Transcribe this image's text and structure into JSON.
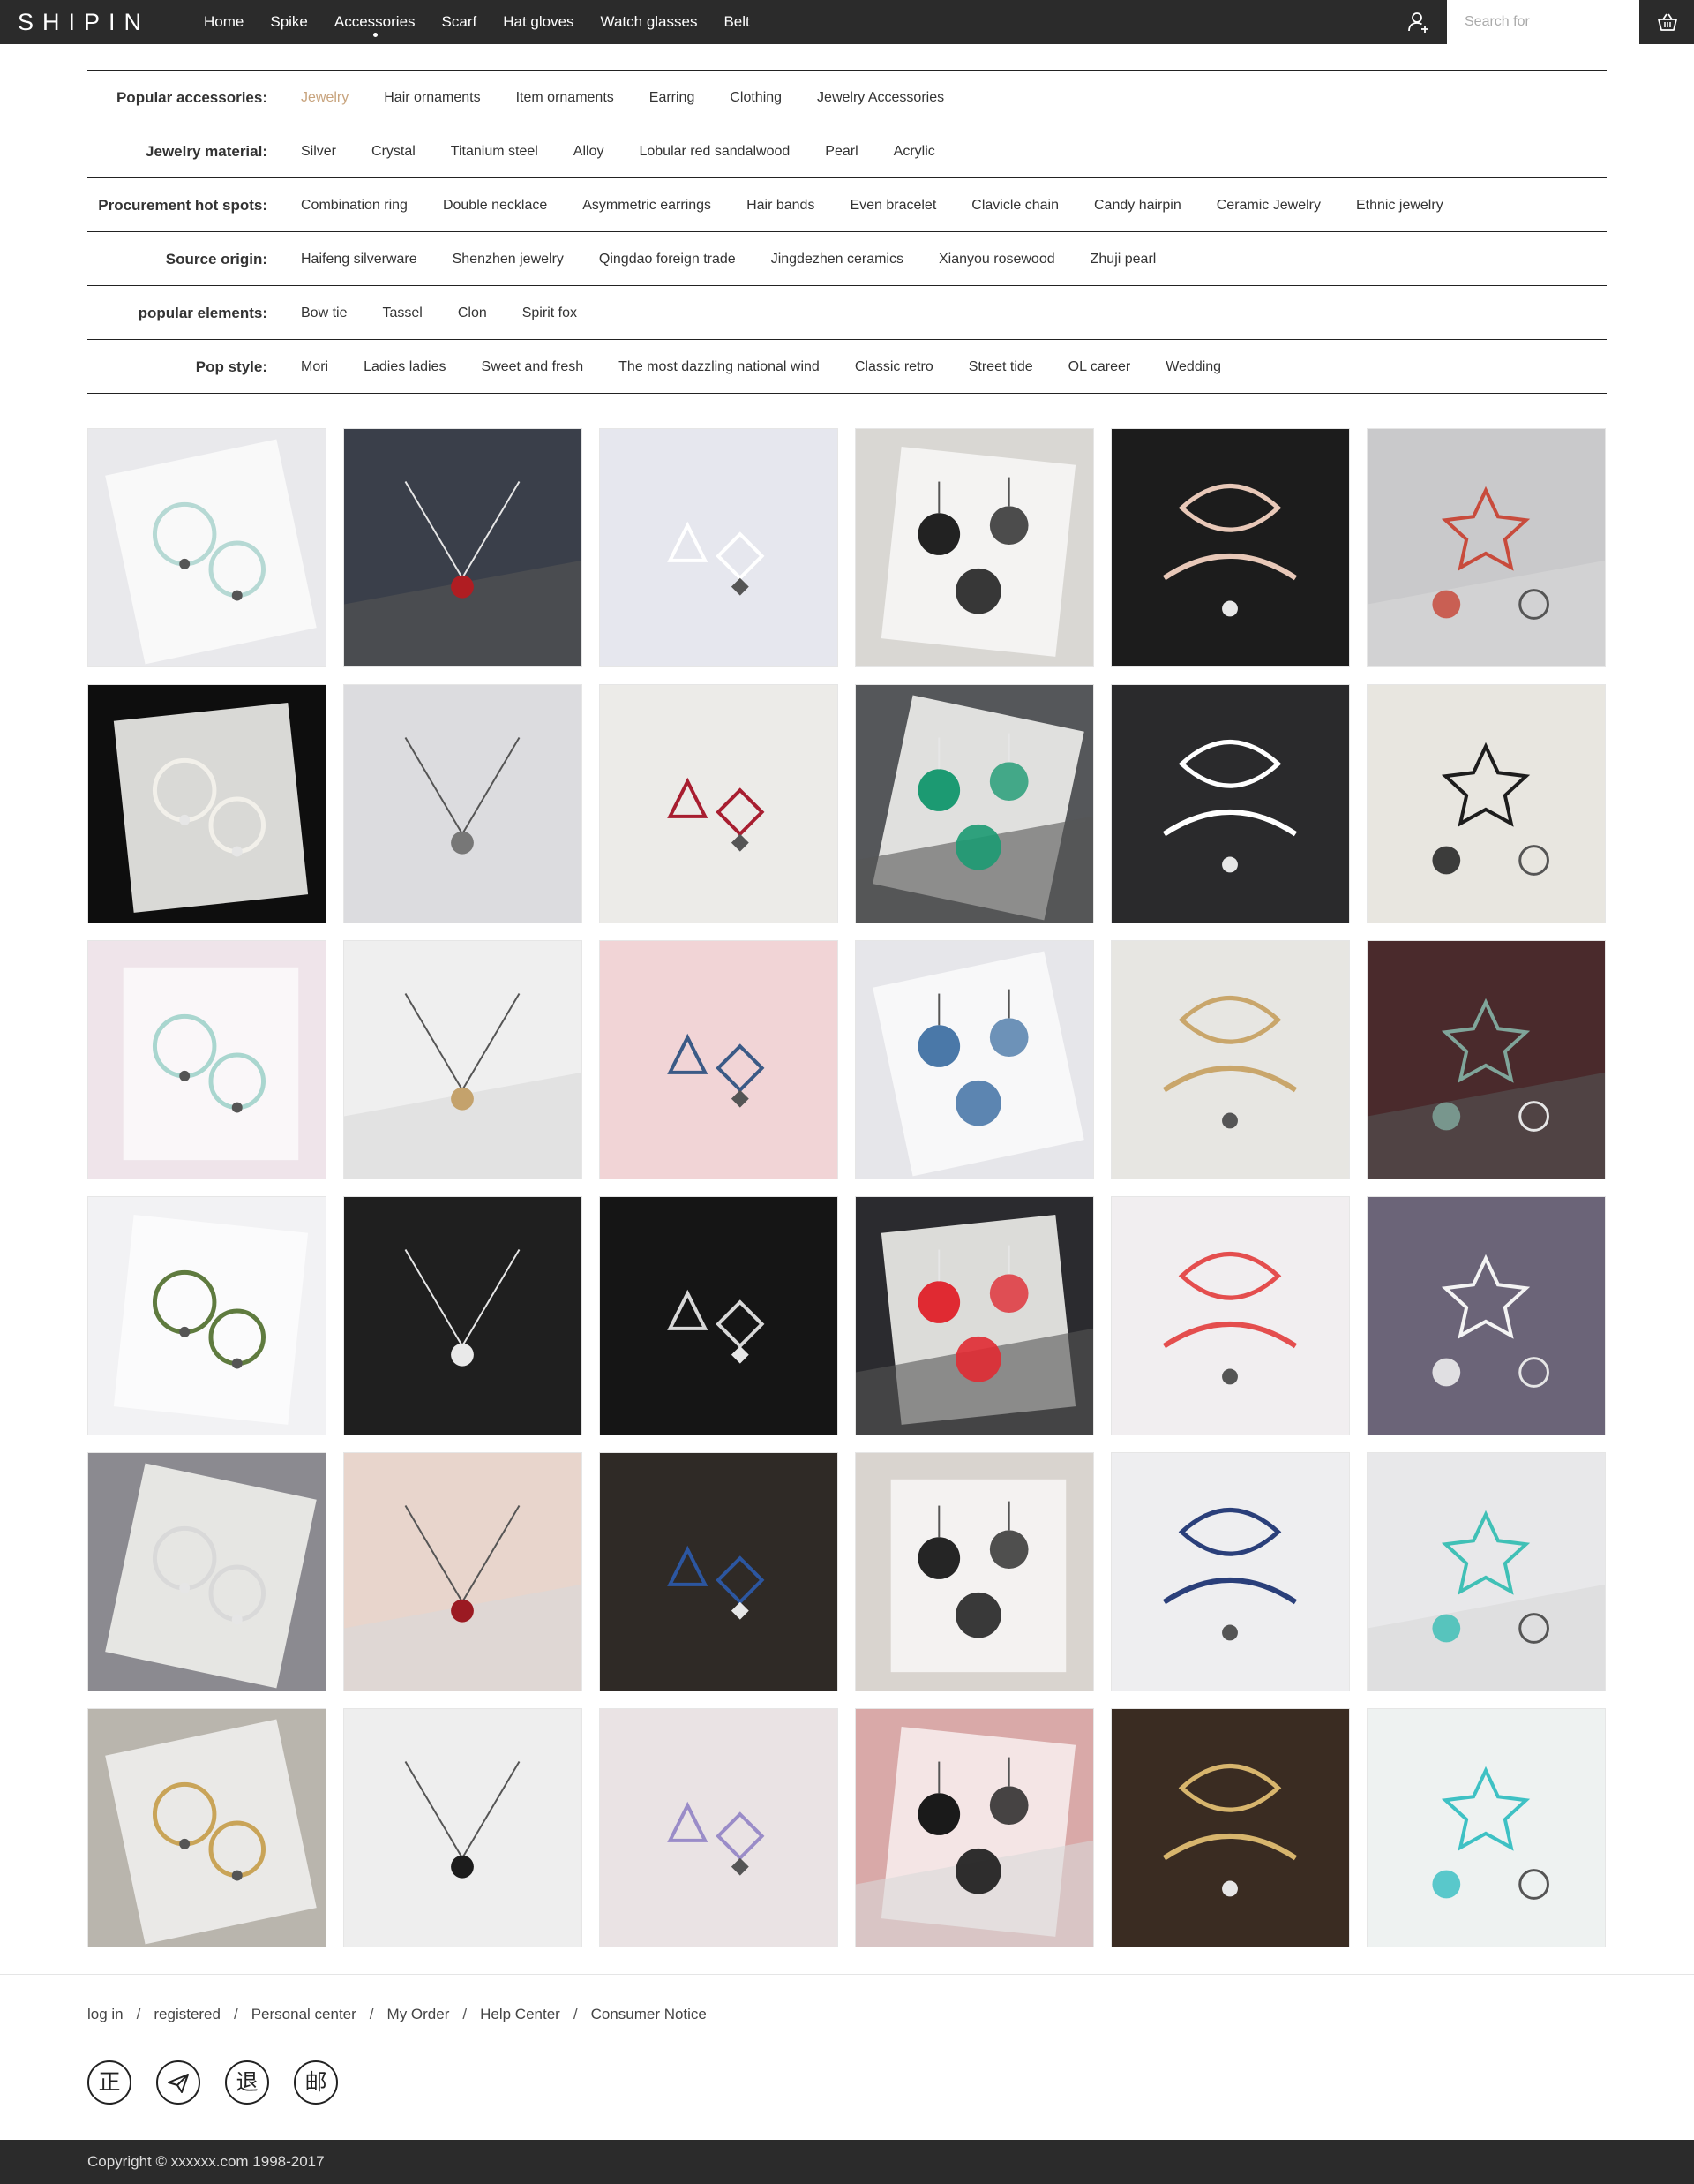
{
  "brand": {
    "logo": "SHIPIN"
  },
  "nav": {
    "items": [
      {
        "label": "Home"
      },
      {
        "label": "Spike"
      },
      {
        "label": "Accessories",
        "active": true
      },
      {
        "label": "Scarf"
      },
      {
        "label": "Hat gloves"
      },
      {
        "label": "Watch glasses"
      },
      {
        "label": "Belt"
      }
    ],
    "user_icon": "user-add-icon",
    "search_placeholder": "Search for",
    "cart_icon": "basket-icon"
  },
  "filters": [
    {
      "label": "Popular accessories:",
      "options": [
        "Jewelry",
        "Hair ornaments",
        "Item ornaments",
        "Earring",
        "Clothing",
        "Jewelry Accessories"
      ],
      "active": "Jewelry"
    },
    {
      "label": "Jewelry material:",
      "options": [
        "Silver",
        "Crystal",
        "Titanium steel",
        "Alloy",
        "Lobular red sandalwood",
        "Pearl",
        "Acrylic"
      ]
    },
    {
      "label": "Procurement hot spots:",
      "options": [
        "Combination ring",
        "Double necklace",
        "Asymmetric earrings",
        "Hair bands",
        "Even bracelet",
        "Clavicle chain",
        "Candy hairpin",
        "Ceramic Jewelry",
        "Ethnic jewelry"
      ]
    },
    {
      "label": "Source origin:",
      "options": [
        "Haifeng silverware",
        "Shenzhen jewelry",
        "Qingdao foreign trade",
        "Jingdezhen ceramics",
        "Xianyou rosewood",
        "Zhuji pearl"
      ]
    },
    {
      "label": "popular elements:",
      "options": [
        "Bow tie",
        "Tassel",
        "Clon",
        "Spirit fox"
      ]
    },
    {
      "label": "Pop style:",
      "options": [
        "Mori",
        "Ladies ladies",
        "Sweet and fresh",
        "The most dazzling national wind",
        "Classic retro",
        "Street tide",
        "OL career",
        "Wedding"
      ]
    }
  ],
  "products": [
    {
      "bg": "#e9e9ec",
      "accent": "#b6d9d4",
      "motif": "shell-earrings"
    },
    {
      "bg": "#3a3f4a",
      "accent": "#b01d22",
      "motif": "ear-stud"
    },
    {
      "bg": "#e6e7ee",
      "accent": "#ffffff",
      "motif": "geometric-necklace"
    },
    {
      "bg": "#d9d7d3",
      "accent": "#222222",
      "motif": "open-ring"
    },
    {
      "bg": "#1c1c1c",
      "accent": "#e8c8b8",
      "motif": "bow-earrings"
    },
    {
      "bg": "#c9c9cb",
      "accent": "#c84b3c",
      "motif": "pendant-figure"
    },
    {
      "bg": "#0e0e0e",
      "accent": "#f2f0ea",
      "motif": "pearl-bracelet"
    },
    {
      "bg": "#dcdcdf",
      "accent": "#777777",
      "motif": "wrist-bracelet"
    },
    {
      "bg": "#ecebe8",
      "accent": "#a81e30",
      "motif": "star-hairclips"
    },
    {
      "bg": "#55575a",
      "accent": "#1c9a72",
      "motif": "color-discs"
    },
    {
      "bg": "#2a2a2c",
      "accent": "#ffffff",
      "motif": "daisy-hairpin"
    },
    {
      "bg": "#e8e6e0",
      "accent": "#1d1d1d",
      "motif": "hair-ties"
    },
    {
      "bg": "#efe4ea",
      "accent": "#a9d6cf",
      "motif": "feather-earrings"
    },
    {
      "bg": "#efefef",
      "accent": "#c4a26c",
      "motif": "gold-ring-cherry"
    },
    {
      "bg": "#f1d4d6",
      "accent": "#3b5a86",
      "motif": "hair-ties-book"
    },
    {
      "bg": "#e6e6ea",
      "accent": "#4a78a8",
      "motif": "chokers"
    },
    {
      "bg": "#e7e6e2",
      "accent": "#c9a66b",
      "motif": "heart-earrings"
    },
    {
      "bg": "#4a2a2c",
      "accent": "#7fa59a",
      "motif": "collar-necklace"
    },
    {
      "bg": "#f2f2f4",
      "accent": "#5f7b3f",
      "motif": "flower-hair-ties"
    },
    {
      "bg": "#1f1f1f",
      "accent": "#e9e9e9",
      "motif": "book-bracelet"
    },
    {
      "bg": "#151515",
      "accent": "#d8d8d8",
      "motif": "cereal-earrings"
    },
    {
      "bg": "#2b2b2f",
      "accent": "#e02a32",
      "motif": "heart-brooches"
    },
    {
      "bg": "#f1eef0",
      "accent": "#e44e4e",
      "motif": "flower-chain-earrings"
    },
    {
      "bg": "#6b6478",
      "accent": "#f4f4f4",
      "motif": "pearl-necklace"
    },
    {
      "bg": "#8b8a90",
      "accent": "#d9d9d9",
      "motif": "square-earring"
    },
    {
      "bg": "#e8d5cc",
      "accent": "#9b1a22",
      "motif": "red-heart-chain"
    },
    {
      "bg": "#2f2a26",
      "accent": "#2c56a0",
      "motif": "hoop-earrings"
    },
    {
      "bg": "#d9d4cf",
      "accent": "#252525",
      "motif": "nice-band"
    },
    {
      "bg": "#eeeef0",
      "accent": "#2a3f7a",
      "motif": "elastic-charms"
    },
    {
      "bg": "#e8e8ea",
      "accent": "#40c0b6",
      "motif": "tassel-earring"
    },
    {
      "bg": "#b9b5ad",
      "accent": "#c9a458",
      "motif": "gold-rings"
    },
    {
      "bg": "#eeeeee",
      "accent": "#1c1c1c",
      "motif": "leaf-studs"
    },
    {
      "bg": "#eae3e4",
      "accent": "#9a8cc8",
      "motif": "star-hair-ties"
    },
    {
      "bg": "#d9a9a8",
      "accent": "#1a1a1a",
      "motif": "stacked-rings"
    },
    {
      "bg": "#3a2c22",
      "accent": "#d7b56d",
      "motif": "necklace-card"
    },
    {
      "bg": "#eef2f1",
      "accent": "#3ec1c4",
      "motif": "cyan-hair-ties"
    }
  ],
  "footer": {
    "links": [
      "log in",
      "registered",
      "Personal center",
      "My Order",
      "Help Center",
      "Consumer Notice"
    ],
    "separator": "/",
    "badges": [
      {
        "glyph": "正",
        "name": "genuine-icon"
      },
      {
        "glyph": "",
        "name": "paper-plane-icon"
      },
      {
        "glyph": "退",
        "name": "return-icon"
      },
      {
        "glyph": "邮",
        "name": "mail-icon"
      }
    ],
    "copyright": "Copyright © xxxxxx.com 1998-2017"
  }
}
